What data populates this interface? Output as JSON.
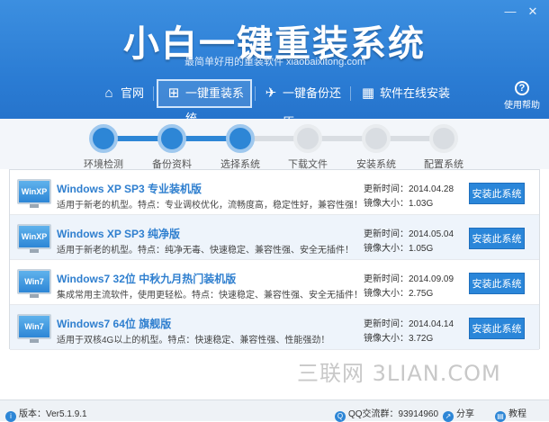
{
  "window": {
    "title": "小白一键重装系统",
    "subtitle": "最简单好用的重装软件 xiaobaixitong.com",
    "controls": [
      "—",
      "✕"
    ]
  },
  "nav": {
    "items": [
      {
        "label": "官网",
        "icon": "home-icon"
      },
      {
        "label": "一键重装系统",
        "icon": "windows-icon"
      },
      {
        "label": "一键备份还原",
        "icon": "bird-icon"
      },
      {
        "label": "软件在线安装",
        "icon": "grid-icon"
      }
    ],
    "help_label": "使用帮助"
  },
  "steps": [
    {
      "label": "环境检测",
      "done": true
    },
    {
      "label": "备份资料",
      "done": true
    },
    {
      "label": "选择系统",
      "done": true
    },
    {
      "label": "下载文件",
      "done": false
    },
    {
      "label": "安装系统",
      "done": false
    },
    {
      "label": "配置系统",
      "done": false
    }
  ],
  "systems": [
    {
      "icon_text": "WinXP",
      "title": "Windows XP SP3 专业装机版",
      "desc": "适用于新老的机型。特点：专业调校优化，流畅度高，稳定性好，兼容性强！",
      "update_label": "更新时间：2014.04.28",
      "size_label": "镜像大小：1.03G",
      "button": "安装此系统"
    },
    {
      "icon_text": "WinXP",
      "title": "Windows XP SP3 纯净版",
      "desc": "适用于新老的机型。特点：纯净无毒、快速稳定、兼容性强、安全无插件！",
      "update_label": "更新时间：2014.05.04",
      "size_label": "镜像大小：1.05G",
      "button": "安装此系统"
    },
    {
      "icon_text": "Win7",
      "title": "Windows7 32位 中秋九月热门装机版",
      "desc": "集成常用主流软件，使用更轻松。特点：快速稳定、兼容性强、安全无插件！",
      "update_label": "更新时间：2014.09.09",
      "size_label": "镜像大小：2.75G",
      "button": "安装此系统"
    },
    {
      "icon_text": "Win7",
      "title": "Windows7 64位 旗舰版",
      "desc": "适用于双核4G以上的机型。特点：快速稳定、兼容性强、性能强劲！",
      "update_label": "更新时间：2014.04.14",
      "size_label": "镜像大小：3.72G",
      "button": "安装此系统"
    }
  ],
  "watermark": "三联网 3LIAN.COM",
  "footer": {
    "version": "版本：Ver5.1.9.1",
    "qq": "QQ交流群：93914960",
    "share": "分享",
    "tutorial": "教程"
  },
  "colors": {
    "header": "#2a7bd3",
    "accent": "#2d86d6",
    "inactive_step": "#d9dde2"
  }
}
